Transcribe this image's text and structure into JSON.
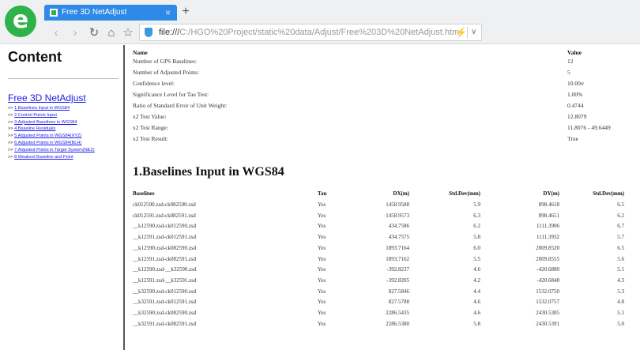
{
  "browser": {
    "tab_title": "Free 3D NetAdjust",
    "tab_close": "×",
    "new_tab": "+",
    "url_scheme": "file:///",
    "url_path": "C:/HGO%20Project/static%20data/Adjust/Free%203D%20NetAdjust.htm",
    "icons": {
      "logo": "browser-e-logo-icon",
      "back": "‹",
      "forward": "›",
      "reload": "↻",
      "home": "⌂",
      "favorite": "☆",
      "bolt": "⚡",
      "dropdown": "∨"
    },
    "colors": {
      "tab": "#2e8ae6",
      "logo": "#2db34a"
    }
  },
  "sidebar": {
    "heading": "Content",
    "project_link": "Free 3D NetAdjust",
    "prefix": ">> ",
    "items": [
      "1.Baselines Input in WGS84",
      "2.Control Points Input",
      "3.Adjusted Baselines in WGS84",
      "4.Baseline Residuals",
      "5.Adjusted Points in WGS84(XYZ)",
      "6.Adjusted Points in WGS84(BLH)",
      "7.Adjusted Points in Target System(NEZ)",
      "8.Weakest Baseline and Point"
    ]
  },
  "summary": {
    "header": {
      "name": "Name",
      "value": "Value"
    },
    "rows": [
      {
        "name": "Number of GPS Baselines:",
        "value": "12"
      },
      {
        "name": "Number of Adjusted Points:",
        "value": "5"
      },
      {
        "name": "Confidence level:",
        "value": "10.00σ"
      },
      {
        "name": "Significance Level for Tau Test:",
        "value": "1.00%"
      },
      {
        "name": "Ratio of Standard Error of Unit Weight:",
        "value": "0.4744"
      },
      {
        "name": "x2 Test Value:",
        "value": "12.8079"
      },
      {
        "name": "x2 Test Range:",
        "value": "11.8076 - 49.6449"
      },
      {
        "name": "x2 Test Result:",
        "value": "True"
      }
    ]
  },
  "section1": {
    "title": "1.Baselines Input in WGS84",
    "columns": [
      "Baselines",
      "Tau",
      "DX(m)",
      "Std.Dev(mm)",
      "DY(m)",
      "Std.Dev(mm)"
    ],
    "rows": [
      [
        "ck012590.zsd-ck082590.zsd",
        "Yes",
        "1458.9588",
        "5.9",
        "898.4618",
        "6.5"
      ],
      [
        "ck012591.zsd-ck082591.zsd",
        "Yes",
        "1458.9573",
        "6.3",
        "898.4651",
        "6.2"
      ],
      [
        "__k12590.zsd-ck012590.zsd",
        "Yes",
        "434.7586",
        "6.2",
        "1111.3906",
        "6.7"
      ],
      [
        "__k12591.zsd-ck012591.zsd",
        "Yes",
        "434.7575",
        "5.8",
        "1111.3932",
        "5.7"
      ],
      [
        "__k12590.zsd-ck082590.zsd",
        "Yes",
        "1893.7164",
        "6.0",
        "2009.8520",
        "6.5"
      ],
      [
        "__k12591.zsd-ck082591.zsd",
        "Yes",
        "1893.7162",
        "5.5",
        "2009.8555",
        "5.6"
      ],
      [
        "__k12590.zsd-__k32590.zsd",
        "Yes",
        "-392.8237",
        "4.6",
        "-420.6880",
        "5.1"
      ],
      [
        "__k12591.zsd-__k32591.zsd",
        "Yes",
        "-392.8205",
        "4.2",
        "-420.6848",
        "4.3"
      ],
      [
        "__k32590.zsd-ck012590.zsd",
        "Yes",
        "827.5846",
        "4.4",
        "1532.0750",
        "5.3"
      ],
      [
        "__k32591.zsd-ck012591.zsd",
        "Yes",
        "827.5788",
        "4.6",
        "1532.0757",
        "4.8"
      ],
      [
        "__k32590.zsd-ck082590.zsd",
        "Yes",
        "2286.5435",
        "4.6",
        "2430.5385",
        "5.1"
      ],
      [
        "__k32591.zsd-ck082591.zsd",
        "Yes",
        "2286.5380",
        "5.8",
        "2430.5391",
        "5.0"
      ]
    ]
  }
}
